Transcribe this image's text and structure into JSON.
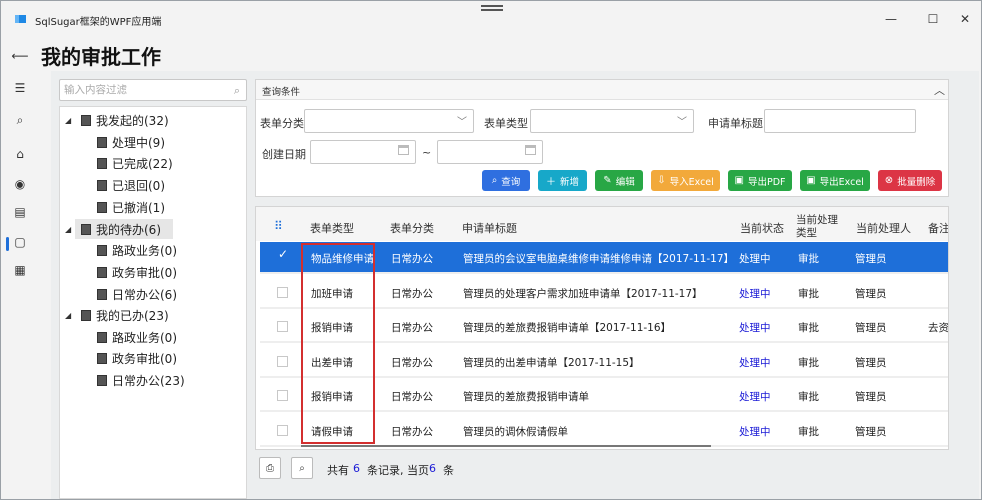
{
  "window": {
    "title": "SqlSugar框架的WPF应用端",
    "minimize": "—",
    "maximize": "☐",
    "close": "✕"
  },
  "page": {
    "title": "我的审批工作"
  },
  "filter": {
    "placeholder": "输入内容过滤",
    "icon": "search-icon"
  },
  "tree": {
    "nodes": [
      {
        "label": "我发起的(32)",
        "level": 0
      },
      {
        "label": "处理中(9)",
        "level": 1
      },
      {
        "label": "已完成(22)",
        "level": 1
      },
      {
        "label": "已退回(0)",
        "level": 1
      },
      {
        "label": "已撤消(1)",
        "level": 1
      },
      {
        "label": "我的待办(6)",
        "level": 0
      },
      {
        "label": "路政业务(0)",
        "level": 1
      },
      {
        "label": "政务审批(0)",
        "level": 1
      },
      {
        "label": "日常办公(6)",
        "level": 1
      },
      {
        "label": "我的已办(23)",
        "level": 0
      },
      {
        "label": "路政业务(0)",
        "level": 1
      },
      {
        "label": "政务审批(0)",
        "level": 1
      },
      {
        "label": "日常办公(23)",
        "level": 1
      }
    ]
  },
  "query": {
    "header": "查询条件",
    "labels": {
      "form_category": "表单分类",
      "form_type": "表单类型",
      "title": "申请单标题",
      "create_date": "创建日期",
      "range_sep": "~"
    },
    "buttons": {
      "search": "查询",
      "add": "新增",
      "edit": "编辑",
      "import_excel": "导入Excel",
      "export_pdf": "导出PDF",
      "export_excel": "导出Excel",
      "batch_delete": "批量删除"
    },
    "colors": {
      "search": "#2f6fe0",
      "add": "#17a8c9",
      "edit": "#28a745",
      "import_excel": "#f2a93b",
      "export_pdf": "#28a745",
      "export_excel": "#28a745",
      "batch_delete": "#dc3545"
    }
  },
  "grid": {
    "columns": {
      "type": "表单类型",
      "category": "表单分类",
      "title": "申请单标题",
      "status": "当前状态",
      "step_line1": "当前处理",
      "step_line2": "类型",
      "handler": "当前处理人",
      "remark": "备注"
    },
    "rows": [
      {
        "type": "物品维修申请",
        "category": "日常办公",
        "title": "管理员的会议室电脑桌维修申请维修申请【2017-11-17】",
        "status": "处理中",
        "step": "审批",
        "handler": "管理员",
        "remark": "",
        "selected": true
      },
      {
        "type": "加班申请",
        "category": "日常办公",
        "title": "管理员的处理客户需求加班申请单【2017-11-17】",
        "status": "处理中",
        "step": "审批",
        "handler": "管理员",
        "remark": "",
        "selected": false
      },
      {
        "type": "报销申请",
        "category": "日常办公",
        "title": "管理员的差旅费报销申请单【2017-11-16】",
        "status": "处理中",
        "step": "审批",
        "handler": "管理员",
        "remark": "去资",
        "selected": false
      },
      {
        "type": "出差申请",
        "category": "日常办公",
        "title": "管理员的出差申请单【2017-11-15】",
        "status": "处理中",
        "step": "审批",
        "handler": "管理员",
        "remark": "",
        "selected": false
      },
      {
        "type": "报销申请",
        "category": "日常办公",
        "title": "管理员的差旅费报销申请单",
        "status": "处理中",
        "step": "审批",
        "handler": "管理员",
        "remark": "",
        "selected": false
      },
      {
        "type": "请假申请",
        "category": "日常办公",
        "title": "管理员的调休假请假单",
        "status": "处理中",
        "step": "审批",
        "handler": "管理员",
        "remark": "",
        "selected": false
      }
    ]
  },
  "pager": {
    "prefix": "共有",
    "total": "6",
    "middle": "条记录, 当页",
    "page_count": "6",
    "suffix": "条"
  }
}
